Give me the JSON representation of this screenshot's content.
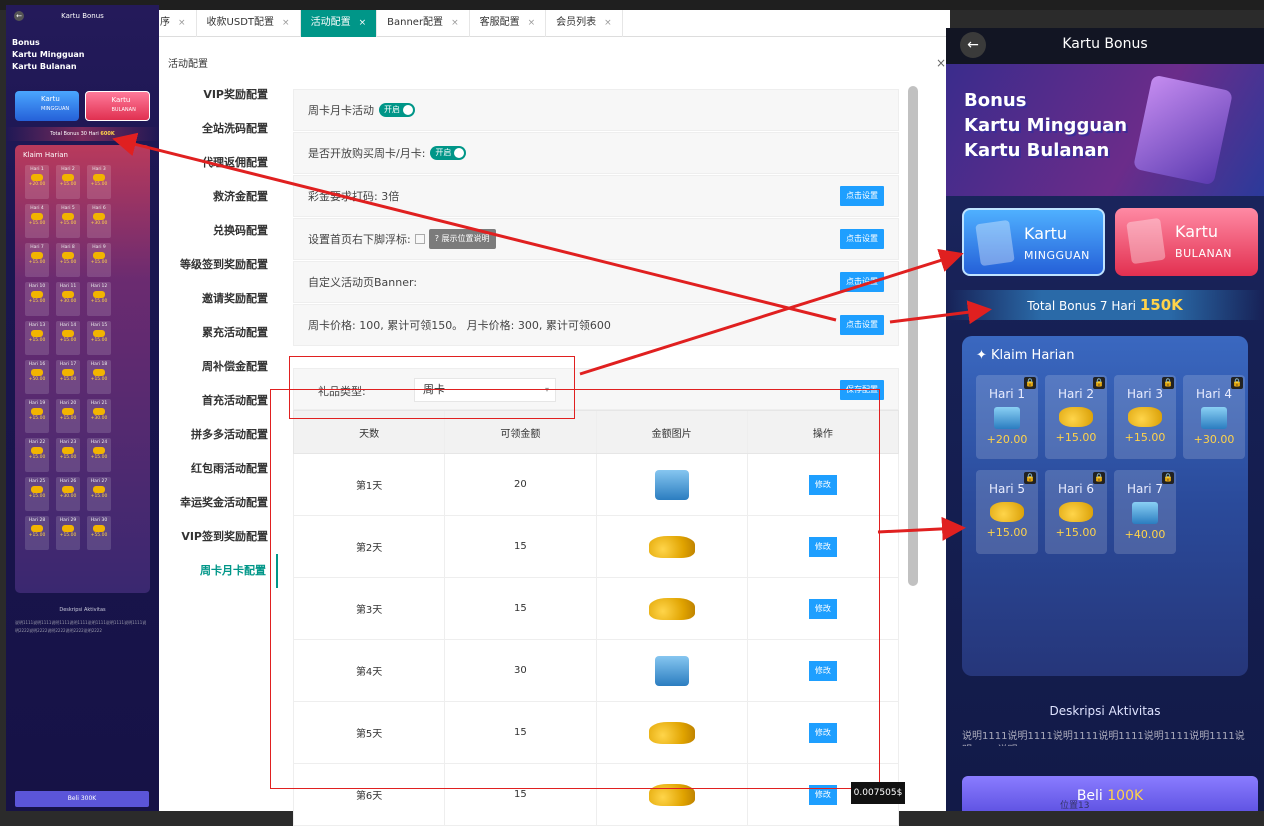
{
  "tabs": [
    {
      "label": "序",
      "close": "×",
      "active": false
    },
    {
      "label": "收款USDT配置",
      "close": "×",
      "active": false
    },
    {
      "label": "活动配置",
      "close": "×",
      "active": true
    },
    {
      "label": "Banner配置",
      "close": "×",
      "active": false
    },
    {
      "label": "客服配置",
      "close": "×",
      "active": false
    },
    {
      "label": "会员列表",
      "close": "×",
      "active": false
    }
  ],
  "page_title": "活动配置",
  "close_glyph": "×",
  "menu": [
    "VIP奖励配置",
    "全站洗码配置",
    "代理返佣配置",
    "救济金配置",
    "兑换码配置",
    "等级签到奖励配置",
    "邀请奖励配置",
    "累充活动配置",
    "周补偿金配置",
    "首充活动配置",
    "拼多多活动配置",
    "红包雨活动配置",
    "幸运奖金活动配置",
    "VIP签到奖励配置",
    "周卡月卡配置"
  ],
  "settings": {
    "row1_label": "周卡月卡活动",
    "row1_toggle": "开启",
    "row2_label": "是否开放购买周卡/月卡:",
    "row2_toggle": "开启",
    "row3_label": "彩金要求打码: 3倍",
    "row4_label": "设置首页右下脚浮标:",
    "row4_tip": "展示位置说明",
    "row5_label": "自定义活动页Banner:",
    "row6_label": "周卡价格: 100, 累计可领150。 月卡价格: 300, 累计可领600",
    "set_button": "点击设置"
  },
  "form": {
    "label": "礼品类型:",
    "select_value": "周卡",
    "save_button": "保存配置"
  },
  "table": {
    "headers": [
      "天数",
      "可领金额",
      "金额图片",
      "操作"
    ],
    "rows": [
      {
        "day": "第1天",
        "amount": "20",
        "img": "box"
      },
      {
        "day": "第2天",
        "amount": "15",
        "img": "gold"
      },
      {
        "day": "第3天",
        "amount": "15",
        "img": "gold"
      },
      {
        "day": "第4天",
        "amount": "30",
        "img": "box"
      },
      {
        "day": "第5天",
        "amount": "15",
        "img": "gold"
      },
      {
        "day": "第6天",
        "amount": "15",
        "img": "gold"
      }
    ],
    "edit_button": "修改"
  },
  "float_badge": "0.007505$",
  "location_text": "位置13",
  "small_phone": {
    "back": "←",
    "title": "Kartu Bonus",
    "banner_lines": [
      "Bonus",
      "Kartu Mingguan",
      "Kartu Bulanan"
    ],
    "card_weekly": {
      "title": "Kartu",
      "sub": "MINGGUAN"
    },
    "card_monthly": {
      "title": "Kartu",
      "sub": "BULANAN"
    },
    "total_prefix": "Total Bonus 30 Hari",
    "total_value": "600K",
    "daily_title": "Klaim Harian",
    "days": [
      {
        "label": "Hari 1",
        "amount": "+20.00"
      },
      {
        "label": "Hari 2",
        "amount": "+15.00"
      },
      {
        "label": "Hari 3",
        "amount": "+15.00"
      },
      {
        "label": "Hari 4",
        "amount": "+15.00"
      },
      {
        "label": "Hari 5",
        "amount": "+15.00"
      },
      {
        "label": "Hari 6",
        "amount": "+30.00"
      },
      {
        "label": "Hari 7",
        "amount": "+15.00"
      },
      {
        "label": "Hari 8",
        "amount": "+15.00"
      },
      {
        "label": "Hari 9",
        "amount": "+15.00"
      },
      {
        "label": "Hari 10",
        "amount": "+15.00"
      },
      {
        "label": "Hari 11",
        "amount": "+30.00"
      },
      {
        "label": "Hari 12",
        "amount": "+15.00"
      },
      {
        "label": "Hari 13",
        "amount": "+15.00"
      },
      {
        "label": "Hari 14",
        "amount": "+15.00"
      },
      {
        "label": "Hari 15",
        "amount": "+15.00"
      },
      {
        "label": "Hari 16",
        "amount": "+50.00"
      },
      {
        "label": "Hari 17",
        "amount": "+15.00"
      },
      {
        "label": "Hari 18",
        "amount": "+15.00"
      },
      {
        "label": "Hari 19",
        "amount": "+15.00"
      },
      {
        "label": "Hari 20",
        "amount": "+15.00"
      },
      {
        "label": "Hari 21",
        "amount": "+30.00"
      },
      {
        "label": "Hari 22",
        "amount": "+15.00"
      },
      {
        "label": "Hari 23",
        "amount": "+15.00"
      },
      {
        "label": "Hari 24",
        "amount": "+15.00"
      },
      {
        "label": "Hari 25",
        "amount": "+15.00"
      },
      {
        "label": "Hari 26",
        "amount": "+30.00"
      },
      {
        "label": "Hari 27",
        "amount": "+15.00"
      },
      {
        "label": "Hari 28",
        "amount": "+15.00"
      },
      {
        "label": "Hari 29",
        "amount": "+15.00"
      },
      {
        "label": "Hari 30",
        "amount": "+55.00"
      }
    ],
    "desc_title": "Deskripsi Aktivitas",
    "desc_text": "说明1111说明1111说明1111说明1111说明1111说明1111说明1111说明2222说明2222说明2222说明2222说明2222",
    "buy_label": "Beli 300K"
  },
  "big_phone": {
    "back": "←",
    "title": "Kartu Bonus",
    "banner_lines": [
      "Bonus",
      "Kartu Mingguan",
      "Kartu Bulanan"
    ],
    "card_weekly": {
      "title": "Kartu",
      "sub": "MINGGUAN"
    },
    "card_monthly": {
      "title": "Kartu",
      "sub": "BULANAN"
    },
    "total_prefix": "Total Bonus 7 Hari",
    "total_value": "150K",
    "daily_title": "Klaim Harian",
    "days": [
      {
        "label": "Hari 1",
        "amount": "+20.00",
        "img": "box"
      },
      {
        "label": "Hari 2",
        "amount": "+15.00",
        "img": "gold"
      },
      {
        "label": "Hari 3",
        "amount": "+15.00",
        "img": "gold"
      },
      {
        "label": "Hari 4",
        "amount": "+30.00",
        "img": "box"
      },
      {
        "label": "Hari 5",
        "amount": "+15.00",
        "img": "gold"
      },
      {
        "label": "Hari 6",
        "amount": "+15.00",
        "img": "gold"
      },
      {
        "label": "Hari 7",
        "amount": "+40.00",
        "img": "box"
      }
    ],
    "desc_title": "Deskripsi Aktivitas",
    "desc_text": "说明1111说明1111说明1111说明1111说明1111说明1111说明1111说明1111",
    "buy_prefix": "Beli",
    "buy_value": "100K"
  },
  "colors": {
    "accent": "#009688",
    "button": "#1e9fff",
    "annotation": "#e02020"
  },
  "icons": [
    "back-arrow-icon",
    "close-icon",
    "lock-icon",
    "gold-coins-icon",
    "gift-box-icon",
    "dropdown-arrow-icon",
    "help-circle-icon"
  ]
}
